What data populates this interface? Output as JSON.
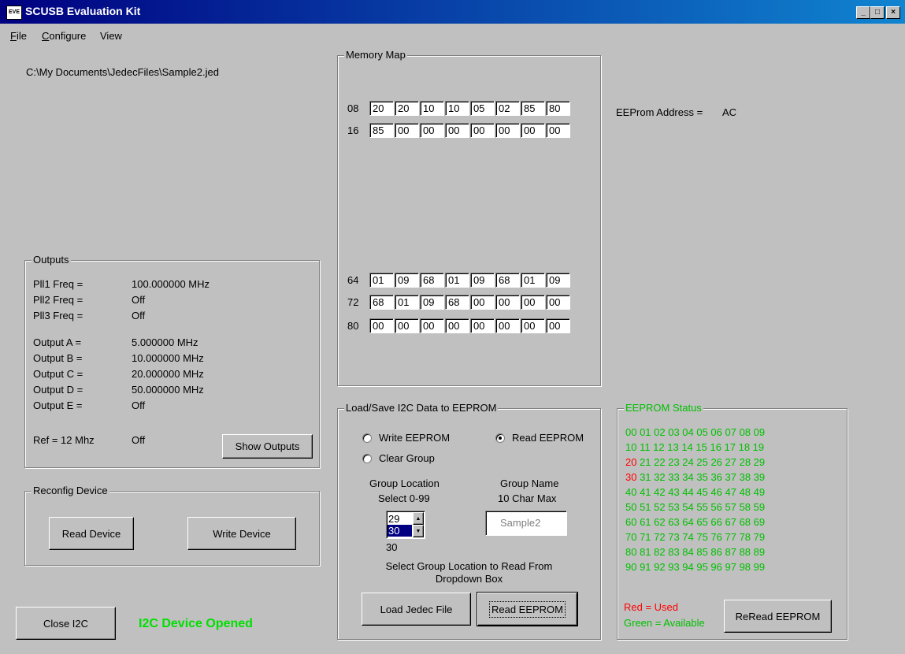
{
  "window": {
    "title": "SCUSB Evaluation Kit",
    "icon_text": "EVE"
  },
  "menu": {
    "file_underline": "F",
    "file_rest": "ile",
    "configure_underline": "C",
    "configure_rest": "onfigure",
    "view": "View"
  },
  "file_path": "C:\\My Documents\\JedecFiles\\Sample2.jed",
  "memory_map": {
    "label": "Memory Map",
    "rows": [
      {
        "label": "08",
        "cells": [
          "20",
          "20",
          "10",
          "10",
          "05",
          "02",
          "85",
          "80"
        ]
      },
      {
        "label": "16",
        "cells": [
          "85",
          "00",
          "00",
          "00",
          "00",
          "00",
          "00",
          "00"
        ]
      },
      {
        "label": "64",
        "cells": [
          "01",
          "09",
          "68",
          "01",
          "09",
          "68",
          "01",
          "09"
        ]
      },
      {
        "label": "72",
        "cells": [
          "68",
          "01",
          "09",
          "68",
          "00",
          "00",
          "00",
          "00"
        ]
      },
      {
        "label": "80",
        "cells": [
          "00",
          "00",
          "00",
          "00",
          "00",
          "00",
          "00",
          "00"
        ]
      }
    ]
  },
  "eeprom_address": {
    "label": "EEProm Address =",
    "value": "AC"
  },
  "outputs": {
    "label": "Outputs",
    "pll": [
      {
        "name": "Pll1 Freq =",
        "value": "100.000000 MHz"
      },
      {
        "name": "Pll2 Freq =",
        "value": "Off"
      },
      {
        "name": "Pll3 Freq =",
        "value": "Off"
      }
    ],
    "outs": [
      {
        "name": "Output A =",
        "value": "5.000000 MHz"
      },
      {
        "name": "Output B =",
        "value": "10.000000 MHz"
      },
      {
        "name": "Output C =",
        "value": "20.000000 MHz"
      },
      {
        "name": "Output D =",
        "value": "50.000000 MHz"
      },
      {
        "name": "Output E =",
        "value": "Off"
      }
    ],
    "ref_label": "Ref = 12 Mhz",
    "ref_value": "Off",
    "show_button": "Show Outputs"
  },
  "reconfig": {
    "label": "Reconfig Device",
    "read_button": "Read Device",
    "write_button": "Write Device"
  },
  "close_button": "Close I2C",
  "status_message": "I2C Device Opened",
  "status_color": "#00e000",
  "load_save": {
    "label": "Load/Save I2C Data to EEPROM",
    "write_radio": "Write EEPROM",
    "read_radio": "Read EEPROM",
    "clear_radio": "Clear Group",
    "selected": "Read EEPROM",
    "group_location_label": "Group Location",
    "group_location_sub": "Select 0-99",
    "group_name_label": "Group Name",
    "group_name_sub": "10 Char Max",
    "list_items": [
      "29",
      "30"
    ],
    "list_selected": "30",
    "group_name_value": "Sample2",
    "current_value": "30",
    "hint_line1": "Select Group Location to Read From",
    "hint_line2": "Dropdown Box",
    "load_button": "Load Jedec File",
    "read_button": "Read EEPROM"
  },
  "eeprom_status": {
    "label": "EEPROM Status",
    "rows": [
      {
        "used": "",
        "rest": "00 01 02 03 04 05 06 07 08 09"
      },
      {
        "used": "",
        "rest": "10 11 12 13 14 15 16 17 18 19"
      },
      {
        "used": "20",
        "rest": " 21 22 23 24 25 26 27 28 29"
      },
      {
        "used": "30",
        "rest": " 31 32 33 34 35 36 37 38 39"
      },
      {
        "used": "",
        "rest": "40 41 42 43 44 45 46 47 48 49"
      },
      {
        "used": "",
        "rest": "50 51 52 53 54 55 56 57 58 59"
      },
      {
        "used": "",
        "rest": "60 61 62 63 64 65 66 67 68 69"
      },
      {
        "used": "",
        "rest": "70 71 72 73 74 75 76 77 78 79"
      },
      {
        "used": "",
        "rest": "80 81 82 83 84 85 86 87 88 89"
      },
      {
        "used": "",
        "rest": "90 91 92 93 94 95 96 97 98 99"
      }
    ],
    "legend_used": "Red = Used",
    "legend_available": "Green = Available",
    "reread_button": "ReRead EEPROM"
  }
}
